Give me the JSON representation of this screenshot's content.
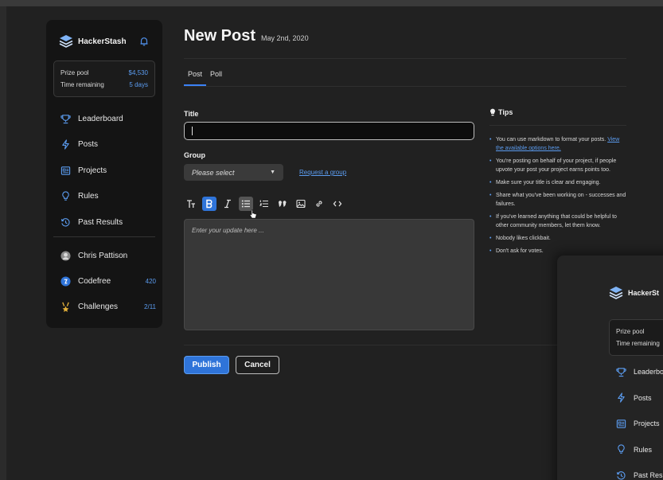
{
  "brand": {
    "name": "HackerStash"
  },
  "prize": {
    "pool_label": "Prize pool",
    "pool_value": "$4,530",
    "time_label": "Time remaining",
    "time_value": "5 days"
  },
  "nav": [
    {
      "label": "Leaderboard",
      "icon": "trophy-icon"
    },
    {
      "label": "Posts",
      "icon": "bolt-icon"
    },
    {
      "label": "Projects",
      "icon": "projects-icon"
    },
    {
      "label": "Rules",
      "icon": "bulb-icon"
    },
    {
      "label": "Past Results",
      "icon": "history-icon"
    }
  ],
  "user": {
    "name": "Chris Pattison"
  },
  "stats": [
    {
      "label": "Codefree",
      "count": "420"
    },
    {
      "label": "Challenges",
      "count": "2/11"
    }
  ],
  "page": {
    "title": "New Post",
    "date": "May 2nd, 2020"
  },
  "tabs": [
    "Post",
    "Poll"
  ],
  "form": {
    "title_label": "Title",
    "title_value": "",
    "group_label": "Group",
    "group_placeholder": "Please select",
    "request_link": "Request a group",
    "editor_placeholder": "Enter your update here ...",
    "publish": "Publish",
    "cancel": "Cancel"
  },
  "tips": {
    "heading": "Tips",
    "items": [
      {
        "text": "You can use markdown to format your posts. ",
        "link": "View the available options here."
      },
      {
        "text": "You're posting on behalf of your project, if people upvote your post your project earns points too."
      },
      {
        "text": "Make sure your title is clear and engaging."
      },
      {
        "text": "Share what you've been working on - successes and failures."
      },
      {
        "text": "If you've learned anything that could be helpful to other community members, let them know."
      },
      {
        "text": "Nobody likes clickbait."
      },
      {
        "text": "Don't ask for votes."
      }
    ]
  },
  "overlay": {
    "brand": "HackerSt",
    "pool_label": "Prize pool",
    "time_label": "Time remaining",
    "nav": [
      "Leaderbo",
      "Posts",
      "Projects",
      "Rules",
      "Past Resu"
    ]
  },
  "colors": {
    "accent": "#2f74d9",
    "link": "#5b9cf0",
    "sidebar": "#141414",
    "background": "#212121"
  }
}
